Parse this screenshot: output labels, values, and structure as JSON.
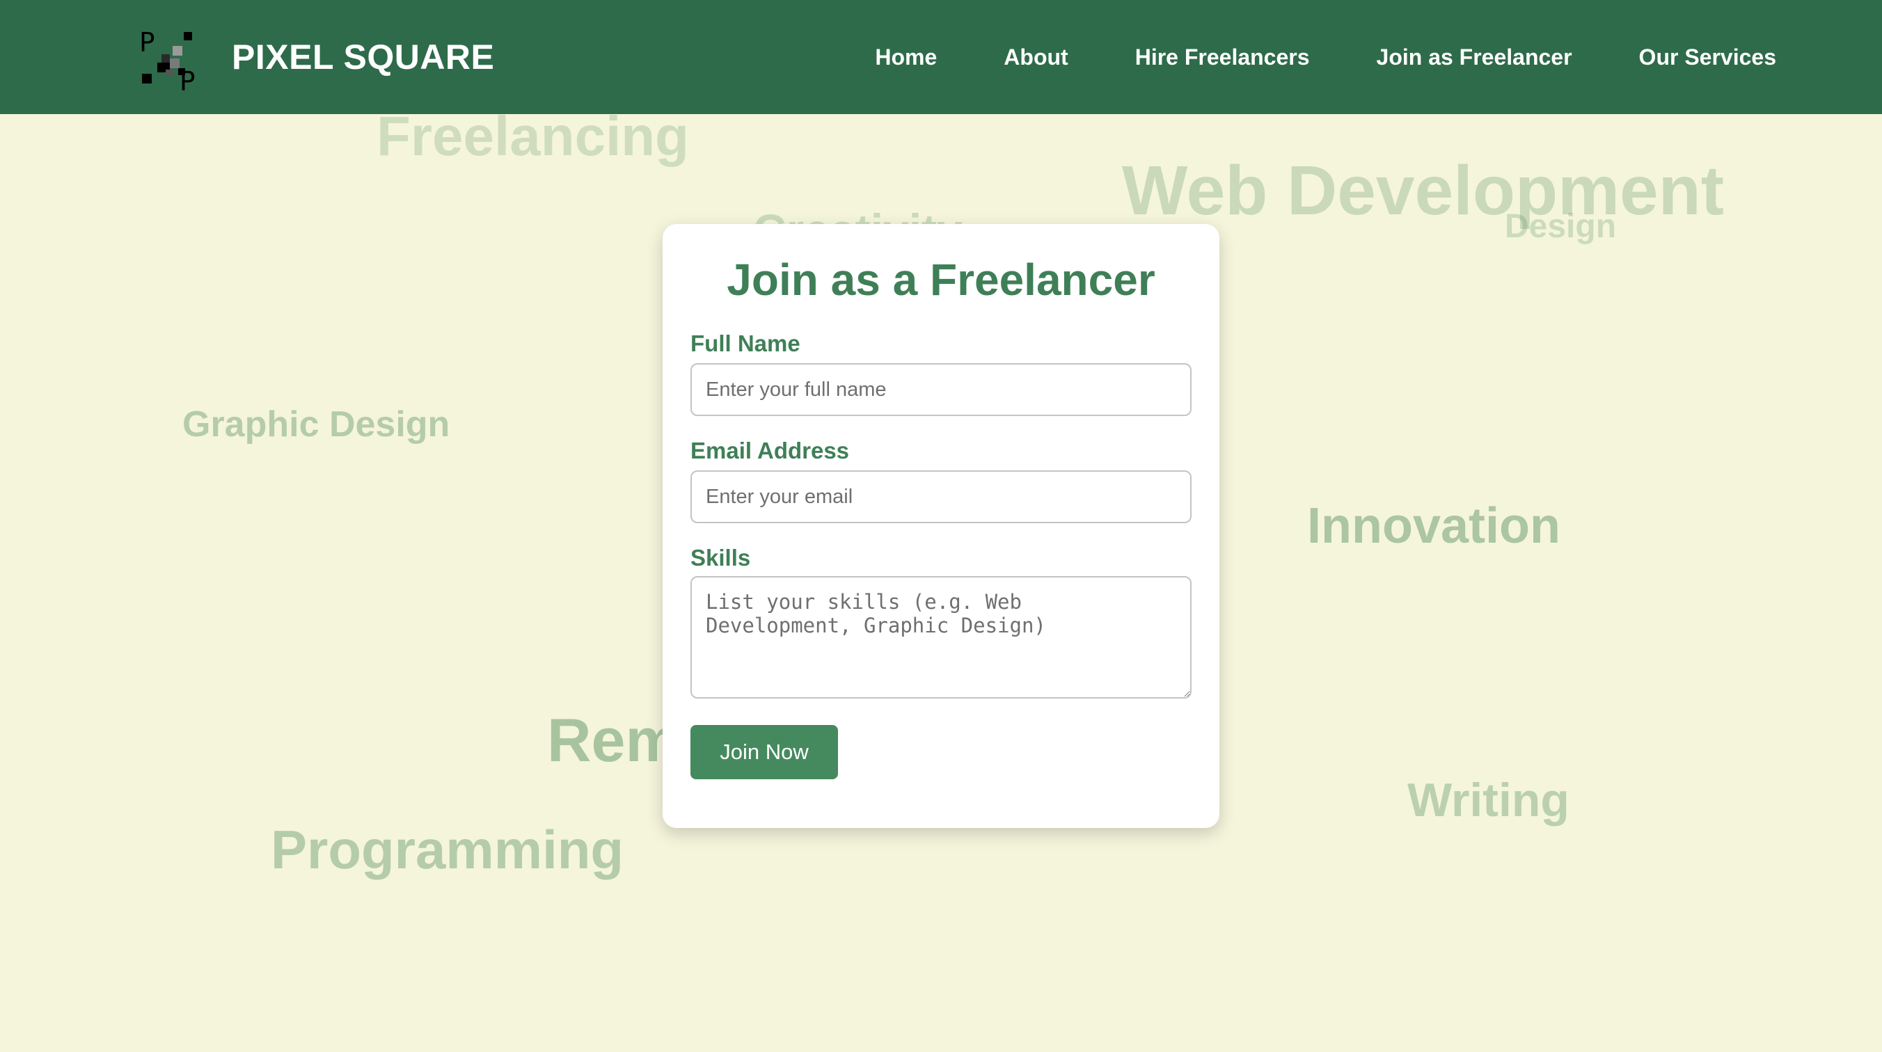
{
  "brand": {
    "name": "PIXEL SQUARE",
    "logo_letters": [
      "P",
      "P"
    ]
  },
  "nav": {
    "items": [
      {
        "label": "Home"
      },
      {
        "label": "About"
      },
      {
        "label": "Hire Freelancers"
      },
      {
        "label": "Join as Freelancer"
      },
      {
        "label": "Our Services"
      }
    ]
  },
  "background_words": [
    "Freelancing",
    "Creativity",
    "Web Development",
    "Design",
    "Graphic Design",
    "Innovation",
    "Remote",
    "Writing",
    "Programming"
  ],
  "form": {
    "title": "Join as a Freelancer",
    "full_name": {
      "label": "Full Name",
      "placeholder": "Enter your full name"
    },
    "email": {
      "label": "Email Address",
      "placeholder": "Enter your email"
    },
    "skills": {
      "label": "Skills",
      "placeholder": "List your skills (e.g. Web Development, Graphic Design)"
    },
    "submit_label": "Join Now"
  },
  "colors": {
    "navbar": "#2e6b4a",
    "page_background": "#f5f5dc",
    "accent": "#3f7f57",
    "button": "#458a5e"
  }
}
